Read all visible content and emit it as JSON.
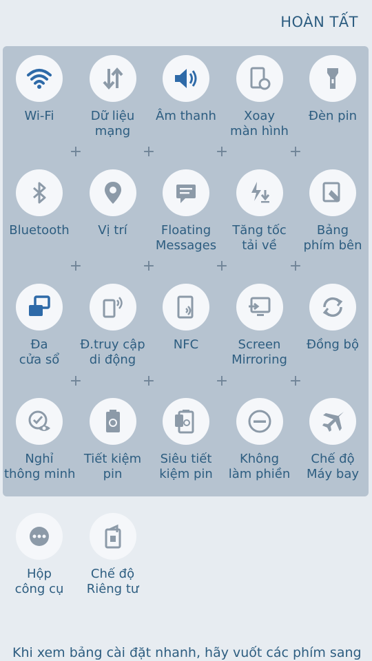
{
  "header": {
    "done_label": "HOÀN TẤT"
  },
  "colors": {
    "active": "#2e6aa8",
    "inactive": "#8c9aa8",
    "text": "#2d5d80",
    "panel": "#b6c3d0"
  },
  "tiles_active": [
    {
      "label1": "Wi-Fi",
      "label2": "",
      "icon": "wifi-icon"
    },
    {
      "label1": "Dữ liệu",
      "label2": "mạng",
      "icon": "mobile-data-icon"
    },
    {
      "label1": "Âm thanh",
      "label2": "",
      "icon": "volume-icon"
    },
    {
      "label1": "Xoay",
      "label2": "màn hình",
      "icon": "rotate-screen-icon"
    },
    {
      "label1": "Đèn pin",
      "label2": "",
      "icon": "flashlight-icon"
    },
    {
      "label1": "Bluetooth",
      "label2": "",
      "icon": "bluetooth-icon"
    },
    {
      "label1": "Vị trí",
      "label2": "",
      "icon": "location-icon"
    },
    {
      "label1": "Floating",
      "label2": "Messages",
      "icon": "floating-messages-icon"
    },
    {
      "label1": "Tăng tốc",
      "label2": "tải về",
      "icon": "download-booster-icon"
    },
    {
      "label1": "Bảng",
      "label2": "phím bên",
      "icon": "side-keyboard-icon"
    },
    {
      "label1": "Đa",
      "label2": "cửa sổ",
      "icon": "multi-window-icon"
    },
    {
      "label1": "Đ.truy cập",
      "label2": "di động",
      "icon": "mobile-hotspot-icon"
    },
    {
      "label1": "NFC",
      "label2": "",
      "icon": "nfc-icon"
    },
    {
      "label1": "Screen",
      "label2": "Mirroring",
      "icon": "screen-mirroring-icon"
    },
    {
      "label1": "Đồng bộ",
      "label2": "",
      "icon": "sync-icon"
    },
    {
      "label1": "Nghỉ",
      "label2": "thông minh",
      "icon": "smart-stay-icon"
    },
    {
      "label1": "Tiết kiệm",
      "label2": "pin",
      "icon": "power-saving-icon"
    },
    {
      "label1": "Siêu tiết",
      "label2": "kiệm pin",
      "icon": "ultra-power-saving-icon"
    },
    {
      "label1": "Không",
      "label2": "làm phiền",
      "icon": "do-not-disturb-icon"
    },
    {
      "label1": "Chế độ",
      "label2": "Máy bay",
      "icon": "airplane-mode-icon"
    }
  ],
  "tiles_extra": [
    {
      "label1": "Hộp",
      "label2": "công cụ",
      "icon": "toolbox-icon"
    },
    {
      "label1": "Chế độ",
      "label2": "Riêng tư",
      "icon": "private-mode-icon"
    }
  ],
  "hint": "Khi xem bảng cài đặt nhanh, hãy vuốt các phím sang"
}
